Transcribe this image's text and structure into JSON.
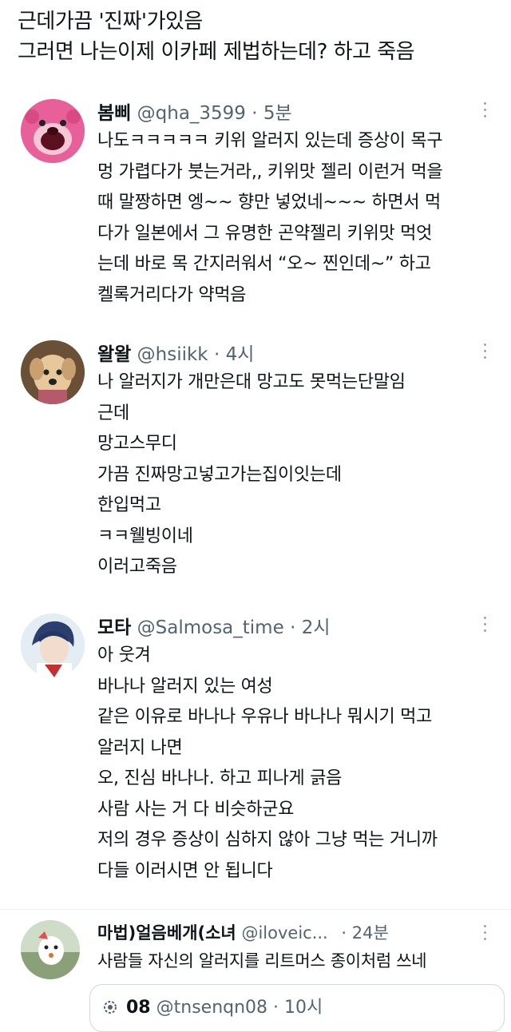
{
  "top_caption": {
    "line1": "근데가끔 '진짜'가있음",
    "line2": "그러면 나는이제 이카페 제법하는데? 하고 죽음"
  },
  "replies": [
    {
      "name": "봄삐",
      "handle": "@qha_3599",
      "dot": "·",
      "time": "5분",
      "avatar_icon": "pink-bear-avatar",
      "lines": [
        "나도ㅋㅋㅋㅋㅋ 키위 알러지 있는데 증상이 목구",
        "멍 가렵다가 붓는거라,, 키위맛 젤리 이런거 먹을",
        "때 말짱하면 엥~~ 향만 넣었네~~~ 하면서 먹",
        "다가 일본에서 그 유명한 곤약젤리 키위맛 먹엇",
        "는데 바로 목 간지러워서 “오~ 찐인데~” 하고",
        "켈록거리다가 약먹음"
      ]
    },
    {
      "name": "왈왈",
      "handle": "@hsiikk",
      "dot": "·",
      "time": "4시",
      "avatar_icon": "puppy-avatar",
      "lines": [
        "나 알러지가 개만은대 망고도 못먹는단말임",
        "근데",
        "망고스무디",
        "가끔 진짜망고넣고가는집이잇는데",
        "한입먹고",
        "ㅋㅋ웰빙이네",
        "이러고죽음"
      ]
    },
    {
      "name": "모타",
      "handle": "@Salmosa_time",
      "dot": "·",
      "time": "2시",
      "avatar_icon": "anime-character-avatar",
      "lines": [
        "아 웃겨",
        "바나나 알러지 있는 여성",
        "같은 이유로 바나나 우유나 바나나 뭐시기 먹고",
        "알러지 나면",
        "오, 진심 바나나. 하고 피나게 긁음",
        "사람 사는 거 다 비슷하군요",
        "저의 경우 증상이 심하지 않아 그냥 먹는 거니까",
        "다들 이러시면 안 됩니다"
      ]
    },
    {
      "name": "마법)얼음베개(소녀",
      "handle": "@iloveic...",
      "dot": "·",
      "time": "24분",
      "avatar_icon": "cartoon-avatar",
      "lines": [
        "사람들 자신의 알러지를 리트머스 종이처럼 쓰네"
      ]
    }
  ],
  "quoted": {
    "name": "08",
    "handle": "@tnsenqn08",
    "dot": "·",
    "time": "10시",
    "icon": "gear-badge-icon"
  },
  "colors": {
    "text": "#0f1419",
    "secondary": "#536471",
    "border": "#cfd9de"
  }
}
